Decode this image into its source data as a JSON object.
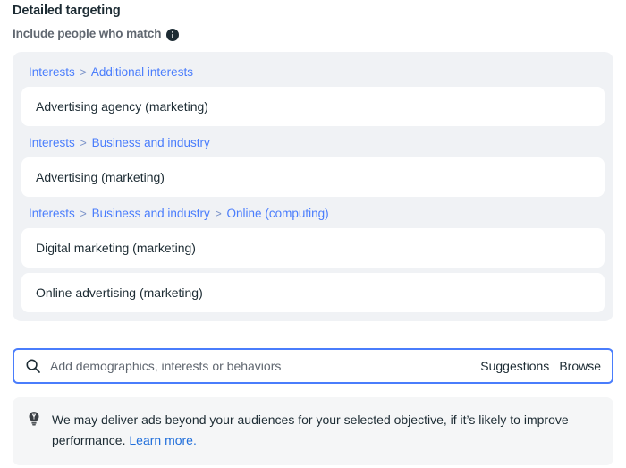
{
  "header": {
    "title": "Detailed targeting",
    "subtitle": "Include people who match",
    "info_icon": "info-icon"
  },
  "targeting": {
    "groups": [
      {
        "breadcrumb": [
          "Interests",
          "Additional interests"
        ],
        "separator": ">",
        "items": [
          "Advertising agency (marketing)"
        ]
      },
      {
        "breadcrumb": [
          "Interests",
          "Business and industry"
        ],
        "separator": ">",
        "items": [
          "Advertising (marketing)"
        ]
      },
      {
        "breadcrumb": [
          "Interests",
          "Business and industry",
          "Online (computing)"
        ],
        "separator": ">",
        "items": [
          "Digital marketing (marketing)",
          "Online advertising (marketing)"
        ]
      }
    ]
  },
  "search": {
    "icon": "search-icon",
    "placeholder": "Add demographics, interests or behaviors",
    "value": "",
    "suggestions_label": "Suggestions",
    "browse_label": "Browse"
  },
  "note": {
    "icon": "lightbulb-icon",
    "text": "We may deliver ads beyond your audiences for your selected objective, if it’s likely to improve performance. ",
    "link_label": "Learn more."
  },
  "colors": {
    "link_blue": "#4a7dfc",
    "note_link_blue": "#216fdb",
    "focus_border": "#4a7dfc",
    "group_background": "#f0f2f5",
    "card_background": "#ffffff",
    "note_background": "#f5f6f7",
    "primary_text": "#1c2b33",
    "secondary_text": "#606770"
  }
}
